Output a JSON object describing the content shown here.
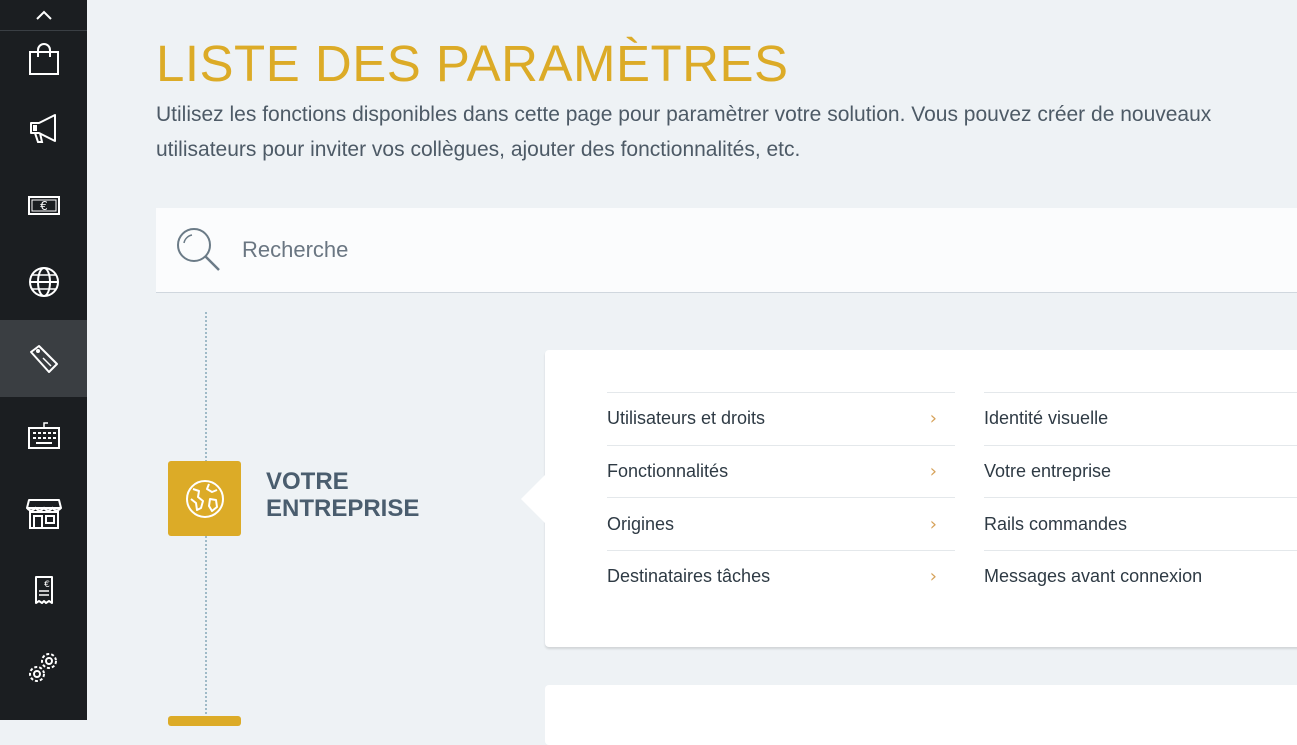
{
  "sidebar": {
    "collapse_icon": "chevron-up-icon",
    "items": [
      {
        "icon": "shopping-bag-icon"
      },
      {
        "icon": "megaphone-icon"
      },
      {
        "icon": "euro-banknote-icon"
      },
      {
        "icon": "globe-icon"
      },
      {
        "icon": "tag-settings-icon",
        "active": true
      },
      {
        "icon": "keyboard-icon"
      },
      {
        "icon": "storefront-icon"
      },
      {
        "icon": "invoice-icon"
      },
      {
        "icon": "gears-icon"
      }
    ]
  },
  "page": {
    "title": "LISTE DES PARAMÈTRES",
    "description_line1": "Utilisez les fonctions disponibles dans cette page pour paramètrer votre solution. Vous pouvez créer de nouveaux",
    "description_line2": "utilisateurs pour inviter vos collègues, ajouter des fonctionnalités, etc."
  },
  "search": {
    "placeholder": "Recherche",
    "value": ""
  },
  "section": {
    "title_line1": "VOTRE",
    "title_line2": "ENTREPRISE",
    "icon": "globe-icon",
    "col1": [
      {
        "label": "Utilisateurs et droits"
      },
      {
        "label": "Fonctionnalités"
      },
      {
        "label": "Origines"
      },
      {
        "label": "Destinataires tâches"
      }
    ],
    "col2": [
      {
        "label": "Identité visuelle"
      },
      {
        "label": "Votre entreprise"
      },
      {
        "label": "Rails commandes"
      },
      {
        "label": "Messages avant connexion"
      }
    ],
    "chevron": "›"
  },
  "colors": {
    "accent": "#dcab27",
    "sidebar_bg": "#1b1e21",
    "sidebar_active": "#3a3e42",
    "page_bg": "#eef2f5",
    "section_title": "#4a5d6e",
    "chevron": "#d6a25a"
  }
}
